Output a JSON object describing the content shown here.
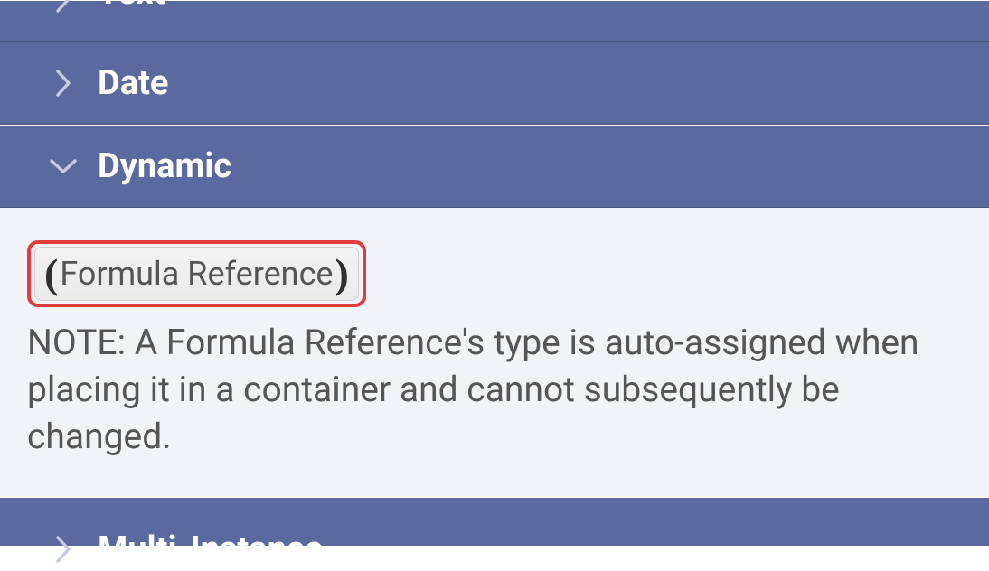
{
  "sections": {
    "text": {
      "label": "Text",
      "expanded": false
    },
    "date": {
      "label": "Date",
      "expanded": false
    },
    "dynamic": {
      "label": "Dynamic",
      "expanded": true
    },
    "multi": {
      "label": "Multi-Instance",
      "expanded": false
    }
  },
  "dynamic_panel": {
    "pill_label": "Formula Reference",
    "note": "NOTE: A Formula Reference's type is auto-assigned when placing it in a container and cannot subsequently be changed."
  }
}
